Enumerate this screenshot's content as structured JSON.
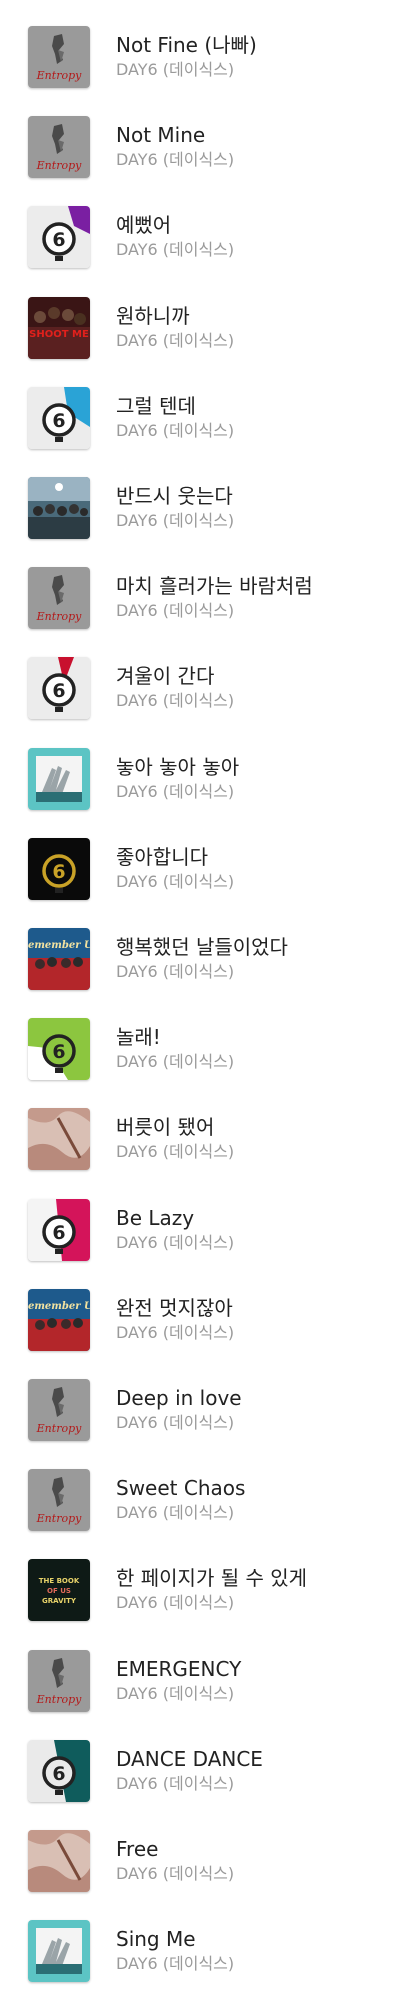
{
  "songs": [
    {
      "title": "Not Fine (나빠)",
      "artist": "DAY6 (데이식스)",
      "cover": "entropy"
    },
    {
      "title": "Not Mine",
      "artist": "DAY6 (데이식스)",
      "cover": "entropy"
    },
    {
      "title": "예뻤어",
      "artist": "DAY6 (데이식스)",
      "cover": "every6-purple"
    },
    {
      "title": "원하니까",
      "artist": "DAY6 (데이식스)",
      "cover": "shoot-me"
    },
    {
      "title": "그럴 텐데",
      "artist": "DAY6 (데이식스)",
      "cover": "every6-blue"
    },
    {
      "title": "반드시 웃는다",
      "artist": "DAY6 (데이식스)",
      "cover": "band-photo"
    },
    {
      "title": "마치 흘러가는 바람처럼",
      "artist": "DAY6 (데이식스)",
      "cover": "entropy"
    },
    {
      "title": "겨울이 간다",
      "artist": "DAY6 (데이식스)",
      "cover": "every6-red"
    },
    {
      "title": "놓아 놓아 놓아",
      "artist": "DAY6 (데이식스)",
      "cover": "teal-hands"
    },
    {
      "title": "좋아합니다",
      "artist": "DAY6 (데이식스)",
      "cover": "every6-gold"
    },
    {
      "title": "행복했던 날들이었다",
      "artist": "DAY6 (데이식스)",
      "cover": "remember-us"
    },
    {
      "title": "놀래!",
      "artist": "DAY6 (데이식스)",
      "cover": "every6-green"
    },
    {
      "title": "버릇이 됐어",
      "artist": "DAY6 (데이식스)",
      "cover": "daydream"
    },
    {
      "title": "Be Lazy",
      "artist": "DAY6 (데이식스)",
      "cover": "every6-pink"
    },
    {
      "title": "완전 멋지잖아",
      "artist": "DAY6 (데이식스)",
      "cover": "remember-us"
    },
    {
      "title": "Deep in love",
      "artist": "DAY6 (데이식스)",
      "cover": "entropy"
    },
    {
      "title": "Sweet Chaos",
      "artist": "DAY6 (데이식스)",
      "cover": "entropy"
    },
    {
      "title": "한 페이지가 될 수 있게",
      "artist": "DAY6 (데이식스)",
      "cover": "book-of-us"
    },
    {
      "title": "EMERGENCY",
      "artist": "DAY6 (데이식스)",
      "cover": "entropy"
    },
    {
      "title": "DANCE DANCE",
      "artist": "DAY6 (데이식스)",
      "cover": "every6-teal"
    },
    {
      "title": "Free",
      "artist": "DAY6 (데이식스)",
      "cover": "daydream"
    },
    {
      "title": "Sing Me",
      "artist": "DAY6 (데이식스)",
      "cover": "teal-hands"
    }
  ],
  "cover_text": {
    "entropy": "Entropy",
    "shoot-me": "SHOOT ME",
    "remember-us": "Remember Us",
    "book-of-us": "THE BOOK OF US GRAVITY",
    "six": "6"
  }
}
